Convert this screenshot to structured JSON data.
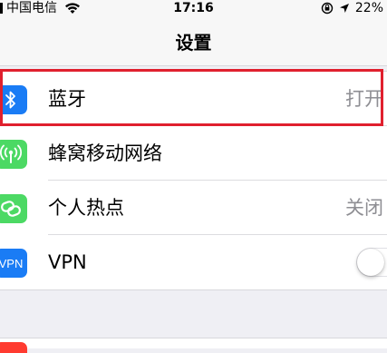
{
  "status_bar": {
    "carrier": "中国电信",
    "time": "17:16",
    "battery": "22%"
  },
  "nav": {
    "title": "设置"
  },
  "settings": {
    "items": [
      {
        "label": "蓝牙",
        "value": "打开",
        "icon": "bluetooth-icon",
        "color": "#1a7cf5"
      },
      {
        "label": "蜂窝移动网络",
        "value": "",
        "icon": "cellular-antenna-icon",
        "color": "#4cd964"
      },
      {
        "label": "个人热点",
        "value": "关闭",
        "icon": "hotspot-chain-icon",
        "color": "#4cd964"
      },
      {
        "label": "VPN",
        "icon_text": "VPN",
        "icon": "vpn-icon",
        "color": "#1a7cf5",
        "toggle_on": false
      }
    ]
  },
  "colors": {
    "highlight": "#e0202e",
    "bottom_icon": "#ff3b30"
  }
}
